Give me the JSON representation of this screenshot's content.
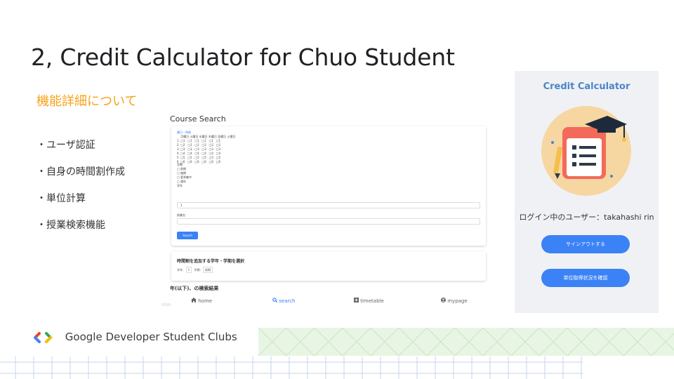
{
  "slide": {
    "title": "2,  Credit Calculator for Chuo Student",
    "subtitle": "機能詳細について",
    "bullets": [
      "・ユーザ認証",
      "・自身の時間割作成",
      "・単位計算",
      "・授業検索機能"
    ],
    "footer_brand": "Google Developer Student Clubs"
  },
  "course_search": {
    "title": "Course Search",
    "weekday_link": "曜日・時限",
    "grid_text": "    月曜日 火曜日 水曜日 木曜日 金曜日 土曜日\n1  □1   □1   □1   □1   □1   □1\n2  □2   □2   □2   □2   □2   □2\n3  □3   □3   □3   □3   □3   □3\n4  □4   □4   □4   □4   □4   □4\n5  □5   □5   □5   □5   □5   □5\n6  □6   □6   □6   □6   □6   □6",
    "term_label": "学期",
    "term_options": [
      "□ 前期",
      "□ 後期",
      "□ 夏季集中",
      "□ 通年"
    ],
    "grade_label": "学年",
    "grade_value": "1",
    "course_name_label": "授業名",
    "search_button": "Search",
    "timetable_card_title": "時間割を追加する学年・学期を選択",
    "grade_prefix": "学年:",
    "grade_select": "1",
    "term_prefix": "学期:",
    "term_select": "前期",
    "results_title": "年(以下)、の検索結果",
    "tabs": [
      {
        "label": "home",
        "icon": "home-icon"
      },
      {
        "label": "search",
        "icon": "search-icon"
      },
      {
        "label": "timetable",
        "icon": "calendar-plus-icon"
      },
      {
        "label": "mypage",
        "icon": "user-icon"
      }
    ]
  },
  "mobile": {
    "title": "Credit Calculator",
    "user_line": "ログイン中のユーザー：takahashi rin",
    "signout_button": "サインアウトする",
    "check_button": "単位取得状況を確認"
  },
  "colors": {
    "accent_orange": "#f6a31b",
    "brand_blue": "#3b82f6",
    "title_blue": "#4a86c7"
  }
}
